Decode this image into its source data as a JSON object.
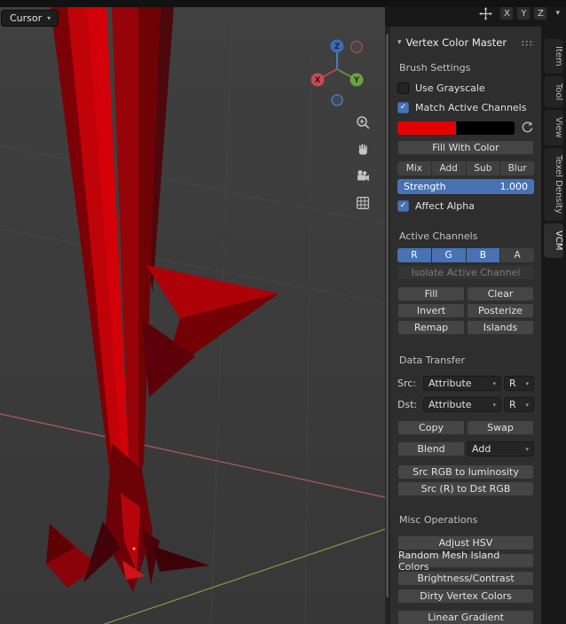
{
  "topbar": {
    "cursor_button": "Cursor",
    "axis_toggles": [
      "X",
      "Y",
      "Z"
    ]
  },
  "viewport": {
    "gizmo": {
      "x_label": "X",
      "y_label": "Y",
      "z_label": "Z"
    }
  },
  "panel": {
    "header": {
      "title": "Vertex Color Master"
    },
    "brush_settings": {
      "label": "Brush Settings",
      "use_grayscale_label": "Use Grayscale",
      "match_active_channels_label": "Match Active Channels",
      "fill_with_color_label": "Fill With Color",
      "blend_buttons": [
        "Mix",
        "Add",
        "Sub",
        "Blur"
      ],
      "strength_label": "Strength",
      "strength_value": "1.000",
      "affect_alpha_label": "Affect Alpha"
    },
    "active_channels": {
      "label": "Active Channels",
      "channel_buttons": [
        "R",
        "G",
        "B",
        "A"
      ],
      "isolate_label": "Isolate Active Channel",
      "row1": [
        "Fill",
        "Clear"
      ],
      "row2": [
        "Invert",
        "Posterize"
      ],
      "row3": [
        "Remap",
        "Islands"
      ]
    },
    "data_transfer": {
      "label": "Data Transfer",
      "src_label": "Src:",
      "dst_label": "Dst:",
      "src_attribute": "Attribute",
      "src_channel": "R",
      "dst_attribute": "Attribute",
      "dst_channel": "R",
      "copy_label": "Copy",
      "swap_label": "Swap",
      "blend_label": "Blend",
      "blend_mode": "Add",
      "src_rgb_luminosity_label": "Src RGB to luminosity",
      "src_r_dst_rgb_label": "Src (R) to Dst RGB"
    },
    "misc_operations": {
      "label": "Misc Operations",
      "adjust_hsv": "Adjust HSV",
      "random_mesh": "Random Mesh Island Colors",
      "brightness": "Brightness/Contrast",
      "dirty": "Dirty Vertex Colors",
      "linear_gradient": "Linear Gradient"
    }
  },
  "sidebar_tabs": [
    {
      "label": "Item"
    },
    {
      "label": "Tool"
    },
    {
      "label": "View"
    },
    {
      "label": "Texel Density"
    },
    {
      "label": "VCM",
      "active": true
    }
  ],
  "icons": {
    "chevron_down": "▾",
    "check": "✓"
  },
  "colors": {
    "accent_blue": "#4772b4",
    "swatch_primary": "#e40000",
    "swatch_secondary": "#000000",
    "axis_x": "#cb4a52",
    "axis_y": "#6ba23f",
    "axis_z": "#3d6cb5"
  }
}
